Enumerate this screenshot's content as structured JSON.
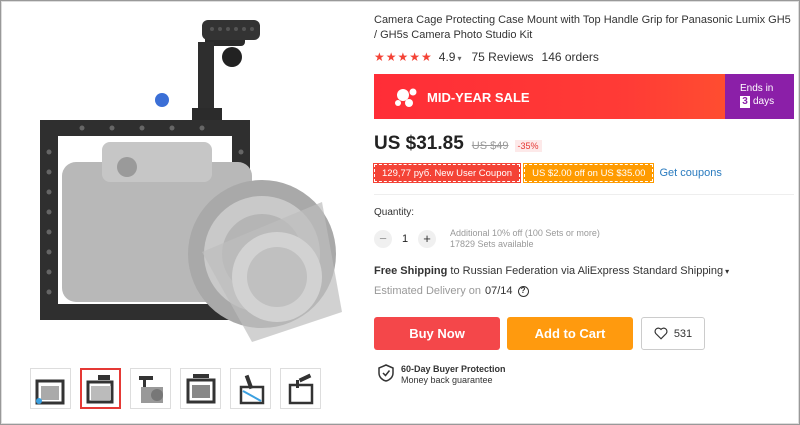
{
  "product": {
    "title": "Camera Cage Protecting Case Mount with Top Handle Grip for Panasonic Lumix GH5 / GH5s Camera Photo Studio Kit",
    "rating": "4.9",
    "stars": "★★★★★",
    "reviews": "75 Reviews",
    "orders": "146 orders"
  },
  "promo": {
    "label": "MID-YEAR SALE",
    "ends_in": "Ends in",
    "days_num": "3",
    "days_word": "days"
  },
  "price": {
    "current": "US $31.85",
    "old": "US $49",
    "discount": "-35%"
  },
  "coupons": {
    "user_coupon": "129,77 руб. New User Coupon",
    "store_coupon": "US $2.00 off on US $35.00",
    "get_coupons": "Get coupons"
  },
  "quantity": {
    "label": "Quantity:",
    "minus": "−",
    "value": "1",
    "plus": "+",
    "note1": "Additional 10% off (100 Sets or more)",
    "note2": "17829 Sets available"
  },
  "shipping": {
    "free": "Free Shipping",
    "rest": " to Russian Federation via AliExpress Standard Shipping",
    "delivery_label": "Estimated Delivery on",
    "delivery_date": "07/14",
    "help": "?"
  },
  "actions": {
    "buy_now": "Buy Now",
    "add_to_cart": "Add to Cart",
    "wishlist_count": "531"
  },
  "protection": {
    "line1": "60-Day Buyer Protection",
    "line2": "Money back guarantee"
  },
  "colors": {
    "accent_red": "#f44336",
    "buy_button": "#f4474a",
    "cart_button": "#ff9a0e",
    "promo_purple": "#8b1fa8",
    "link_blue": "#2a7bbf"
  },
  "icons": [
    "camera-cage-image",
    "star-icon",
    "heart-icon",
    "shield-check-icon",
    "help-icon",
    "sale-logo-icon"
  ]
}
